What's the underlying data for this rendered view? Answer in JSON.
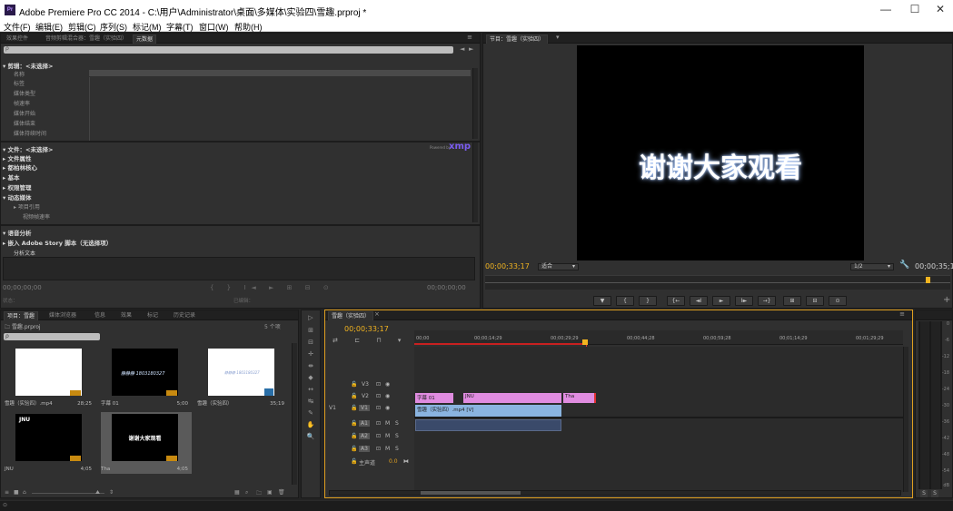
{
  "window": {
    "title": "Adobe Premiere Pro CC 2014 - C:\\用户\\Administrator\\桌面\\多媒体\\实验四\\雪趣.prproj *",
    "logo": "Pr",
    "minimize": "—",
    "maximize": "☐",
    "close": "✕"
  },
  "menu": [
    "文件(F)",
    "编辑(E)",
    "剪辑(C)",
    "序列(S)",
    "标记(M)",
    "字幕(T)",
    "窗口(W)",
    "帮助(H)"
  ],
  "metadata_panel": {
    "tabs": [
      "效果控件",
      "音频剪辑混合器：雪趣（实验四）",
      "元数据"
    ],
    "menu_icon": "≡",
    "search_placeholder": "ρ",
    "clip_section": "剪辑：<未选择>",
    "clip_fields": [
      "名称",
      "标签",
      "媒体类型",
      "帧速率",
      "媒体开始",
      "媒体结束",
      "媒体持续时间"
    ],
    "file_section": "文件：<未选择>",
    "powered_by": "Powered by",
    "xmp": "xmp",
    "file_groups": [
      "文件属性",
      "都柏林核心",
      "基本",
      "权限管理",
      "动态媒体"
    ],
    "file_subitems": [
      "项目引用",
      "视频帧速率"
    ],
    "speech_section": "语音分析",
    "story_row": "嵌入 Adobe Story 脚本（无选择项）",
    "analyze_label": "分析文本",
    "timecode_left": "00;00;00;00",
    "timecode_right": "00;00;00;00",
    "status_left": "状态：",
    "status_mid": "已编辑："
  },
  "program_monitor": {
    "tab": "节目：雪趣（实验四）",
    "frame_text": "谢谢大家观看",
    "timecode": "00;00;33;17",
    "fit": "适合",
    "resolution": "1/2",
    "duration": "00;00;35;19",
    "transport": [
      "▼",
      "{",
      "}",
      "{←",
      "◄I",
      "►",
      "I►",
      "→}",
      "⊞",
      "⊟",
      "⊙"
    ]
  },
  "project_panel": {
    "tabs": [
      "项目：雪趣",
      "媒体浏览器",
      "信息",
      "效果",
      "标记",
      "历史记录"
    ],
    "project_file": "雪趣.prproj",
    "item_count": "5 个项",
    "search_placeholder": "ρ",
    "items": [
      {
        "name": "雪趣（实验四）.mp4",
        "duration": "28;25",
        "style": "white"
      },
      {
        "name": "字幕 01",
        "duration": "5;00",
        "style": "dark-text",
        "thumb_text": "静静静 1803180327"
      },
      {
        "name": "雪趣（实验四）",
        "duration": "35;19",
        "style": "white-text",
        "thumb_text": "静静静 1803180327"
      },
      {
        "name": "JNU",
        "duration": "4;05",
        "style": "jnu",
        "thumb_text": "JNU"
      },
      {
        "name": "Tha",
        "duration": "4;05",
        "style": "tha",
        "thumb_text": "谢谢大家观看"
      }
    ]
  },
  "tools": [
    "▷",
    "⊞",
    "⊟",
    "✛",
    "⇼",
    "◆",
    "↔",
    "↹",
    "✎",
    "✋",
    "🔍"
  ],
  "timeline": {
    "tab": "雪趣（实验四）",
    "timecode": "00;00;33;17",
    "ruler": [
      "00;00",
      "00;00;14;29",
      "00;00;29;29",
      "00;00;44;28",
      "00;00;59;28",
      "00;01;14;29",
      "00;01;29;29"
    ],
    "video_tracks": [
      "V3",
      "V2",
      "V1"
    ],
    "audio_tracks": [
      "A1",
      "A2",
      "A3"
    ],
    "master": "主声道",
    "master_value": "0.0",
    "clips": {
      "title01": "字幕 01",
      "jnu": "JNU",
      "tha": "Tha",
      "v1": "雪趣（实验四）.mp4 [V]"
    }
  },
  "meter": {
    "labels": [
      "0",
      "-6",
      "-12",
      "-18",
      "-24",
      "-30",
      "-36",
      "-42",
      "-48",
      "-54",
      "dB"
    ],
    "solo": "S",
    "solo2": "S"
  }
}
